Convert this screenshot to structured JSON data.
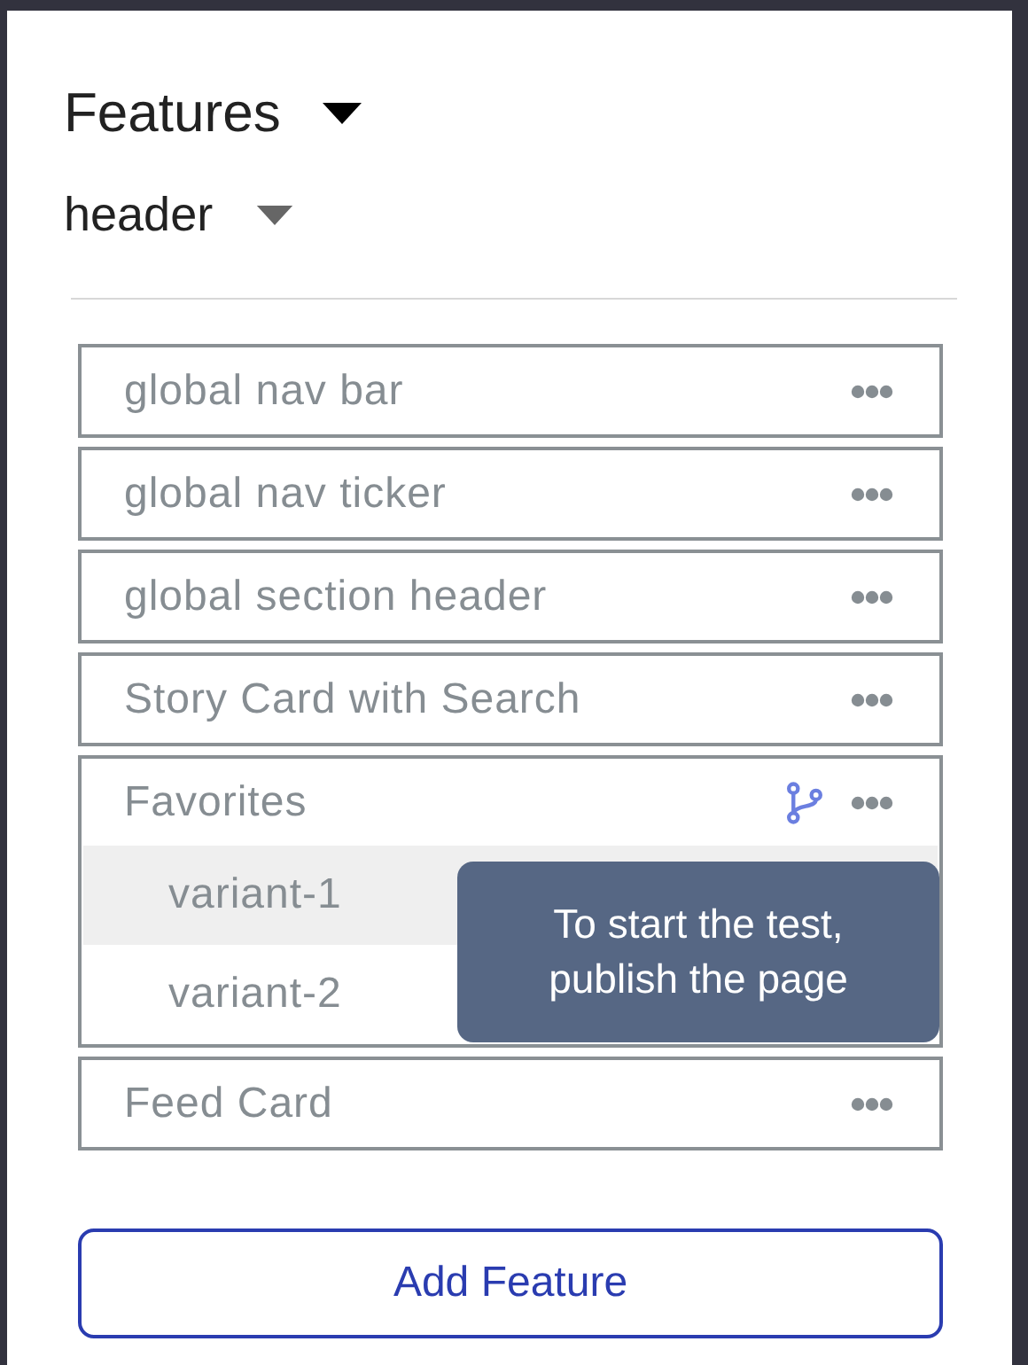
{
  "panel": {
    "title": "Features",
    "section": "header"
  },
  "features": [
    {
      "label": "global nav bar"
    },
    {
      "label": "global nav ticker"
    },
    {
      "label": "global section header"
    },
    {
      "label": "Story Card with Search"
    },
    {
      "label": "Favorites",
      "variants": [
        {
          "label": "variant-1",
          "selected": true
        },
        {
          "label": "variant-2",
          "selected": false
        }
      ],
      "tooltip": "To start the test, publish the page"
    },
    {
      "label": "Feed Card"
    }
  ],
  "add_button": "Add Feature"
}
